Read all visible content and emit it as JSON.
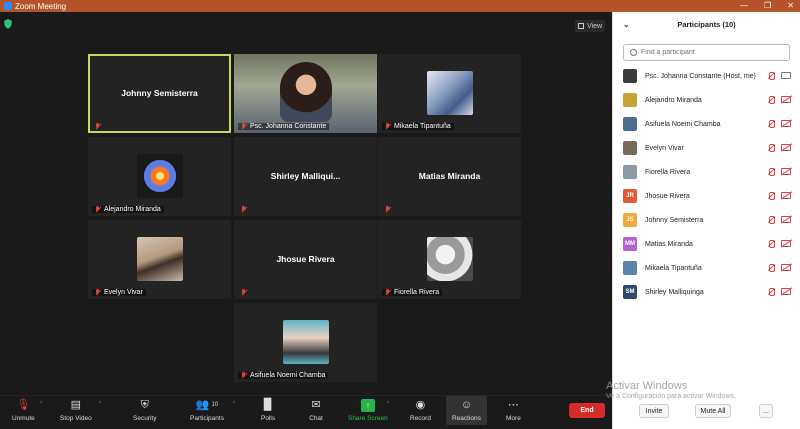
{
  "window": {
    "title": "Zoom Meeting"
  },
  "view_label": "View",
  "tiles": [
    {
      "name": "Johnny Semisterra",
      "label": ""
    },
    {
      "name": "",
      "label": "Psc. Johanna Constante"
    },
    {
      "name": "",
      "label": "Mikaela Tipantuña"
    },
    {
      "name": "",
      "label": "Alejandro Miranda"
    },
    {
      "name": "Shirley  Malliqui...",
      "label": ""
    },
    {
      "name": "Matias Miranda",
      "label": ""
    },
    {
      "name": "",
      "label": "Evelyn Vivar"
    },
    {
      "name": "Jhosue Rivera",
      "label": ""
    },
    {
      "name": "",
      "label": "Fiorella Rivera"
    },
    {
      "name": "",
      "label": "Asifuela Noemi Chamba"
    }
  ],
  "toolbar": {
    "unmute": "Unmute",
    "stop_video": "Stop Video",
    "security": "Security",
    "participants": "Participants",
    "participants_count": "10",
    "polls": "Polls",
    "chat": "Chat",
    "share_screen": "Share Screen",
    "record": "Record",
    "reactions": "Reactions",
    "more": "More",
    "end": "End"
  },
  "panel": {
    "title": "Participants (10)",
    "search_placeholder": "Find a participant",
    "participants": [
      {
        "name": "Psc. Johanna Constante (Host, me)",
        "initials": "",
        "color": "#3b3b3b"
      },
      {
        "name": "Alejandro Miranda",
        "initials": "",
        "color": "#c7a235"
      },
      {
        "name": "Asifuela Noemi Chamba",
        "initials": "",
        "color": "#4c6e8c"
      },
      {
        "name": "Evelyn Vivar",
        "initials": "",
        "color": "#7a6a5a"
      },
      {
        "name": "Fiorella Rivera",
        "initials": "",
        "color": "#8c9aa8"
      },
      {
        "name": "Jhosue Rivera",
        "initials": "JR",
        "color": "#e35a38"
      },
      {
        "name": "Johnny Semisterra",
        "initials": "JS",
        "color": "#f2a93b"
      },
      {
        "name": "Matias Miranda",
        "initials": "MM",
        "color": "#b45fd3"
      },
      {
        "name": "Mikaela Tipantuña",
        "initials": "",
        "color": "#5a84a8"
      },
      {
        "name": "Shirley Malliquinga",
        "initials": "SM",
        "color": "#2e4a6e"
      }
    ],
    "invite": "Invite",
    "mute_all": "Mute All",
    "more": "..."
  },
  "watermark": {
    "title": "Activar Windows",
    "subtitle": "Ve a Configuración para activar Windows."
  }
}
